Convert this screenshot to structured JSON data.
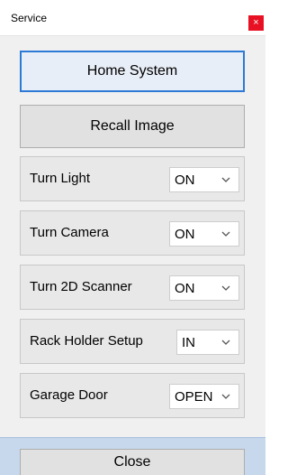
{
  "window": {
    "title": "Service",
    "close_glyph": "×"
  },
  "buttons": {
    "home_system": "Home System",
    "recall_image": "Recall Image",
    "close": "Close"
  },
  "settings": [
    {
      "label": "Turn Light",
      "value": "ON"
    },
    {
      "label": "Turn Camera",
      "value": "ON"
    },
    {
      "label": "Turn 2D Scanner",
      "value": "ON"
    },
    {
      "label": "Rack Holder Setup",
      "value": "IN"
    },
    {
      "label": "Garage Door",
      "value": "OPEN"
    }
  ],
  "icons": {
    "dropdown": "chevron-down-icon",
    "window_close": "close-icon"
  },
  "colors": {
    "focus_border": "#2d7ad6",
    "close_button": "#e81123",
    "footer_bar": "#c7d8ec"
  }
}
